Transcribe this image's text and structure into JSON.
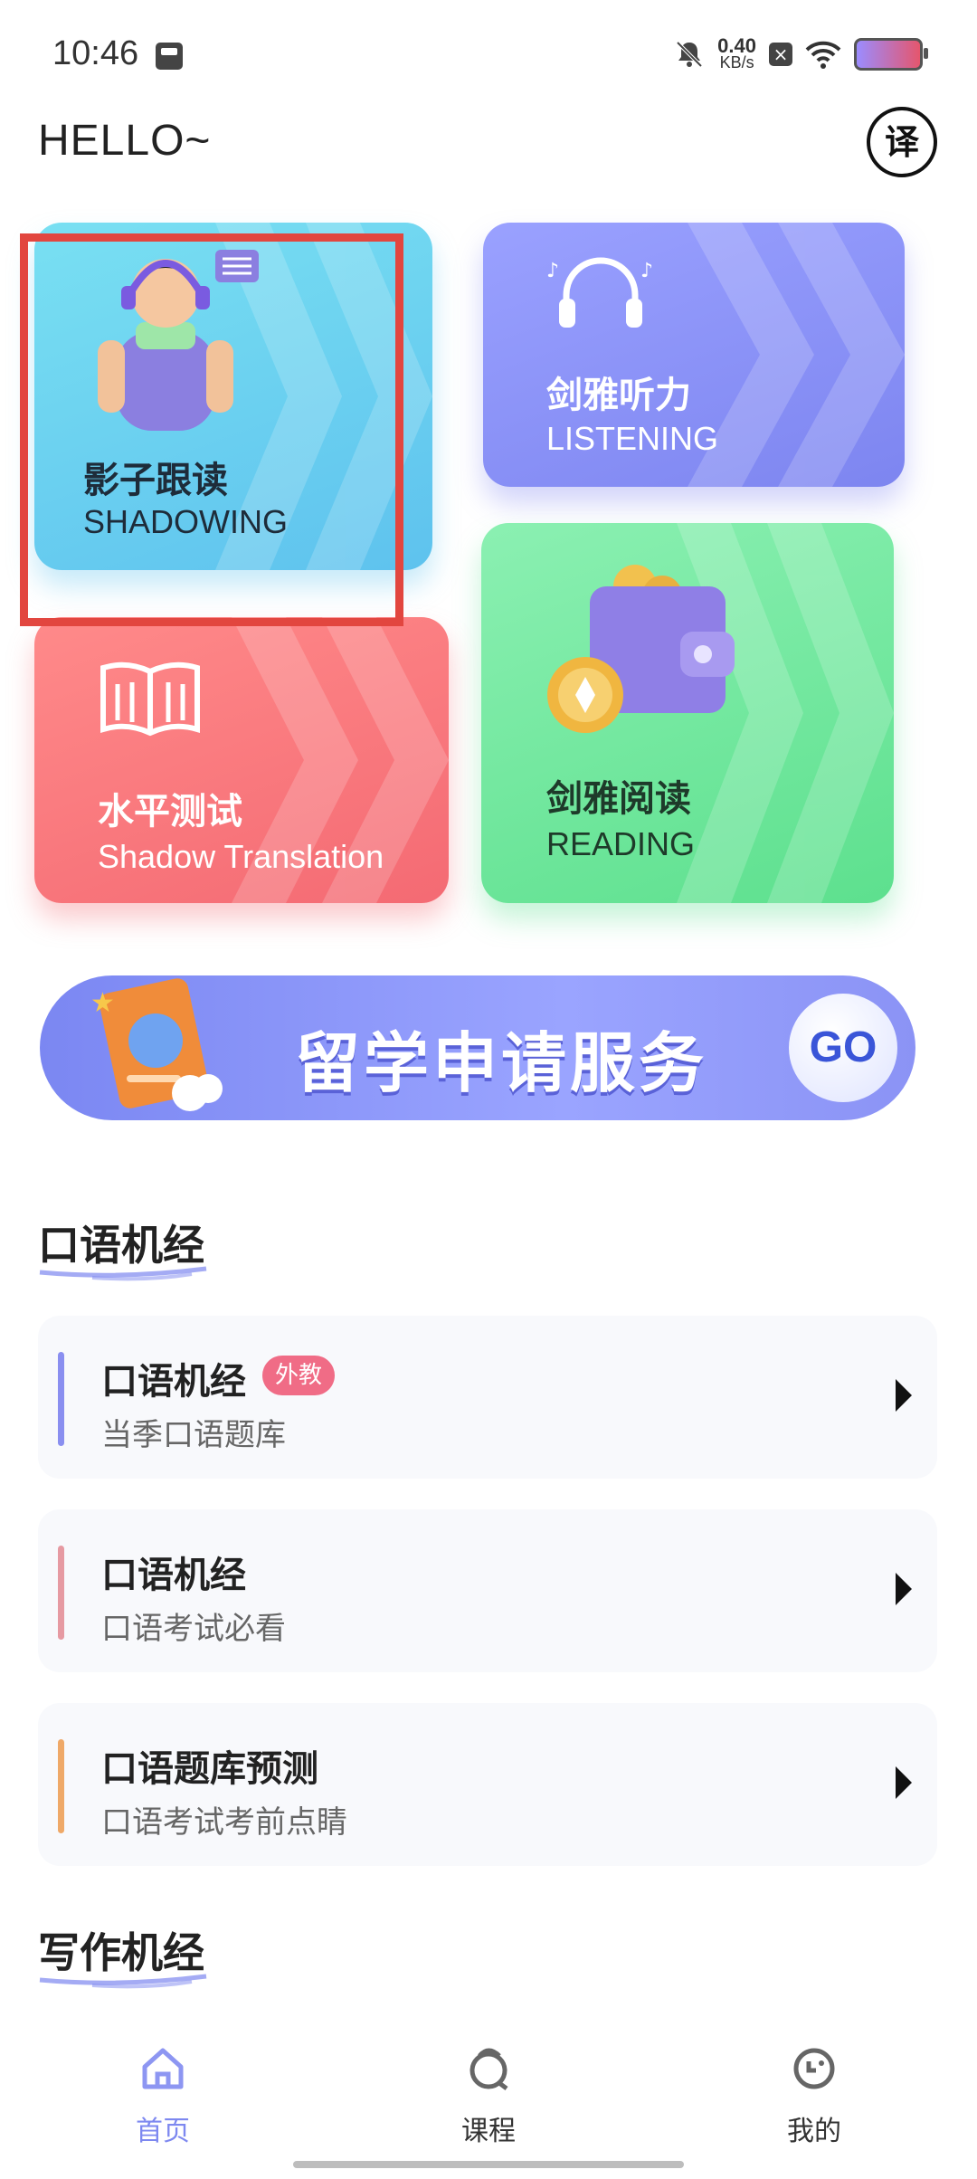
{
  "status_bar": {
    "time": "10:46",
    "net_speed_value": "0.40",
    "net_speed_unit": "KB/s"
  },
  "header": {
    "greeting": "HELLO~",
    "translate_label": "译"
  },
  "cards": {
    "shadowing": {
      "title": "影子跟读",
      "subtitle": "SHADOWING"
    },
    "listening": {
      "title": "剑雅听力",
      "subtitle": "LISTENING"
    },
    "level_test": {
      "title": "水平测试",
      "subtitle": "Shadow Translation"
    },
    "reading": {
      "title": "剑雅阅读",
      "subtitle": "READING"
    }
  },
  "banner": {
    "text": "留学申请服务",
    "go_label": "GO"
  },
  "sections": {
    "speaking": "口语机经",
    "writing": "写作机经"
  },
  "speaking_items": [
    {
      "name": "口语机经",
      "badge": "外教",
      "desc": "当季口语题库",
      "color": "#8a8ff0"
    },
    {
      "name": "口语机经",
      "desc": "口语考试必看",
      "color": "#e69aa2"
    },
    {
      "name": "口语题库预测",
      "desc": "口语考试考前点睛",
      "color": "#efa968"
    }
  ],
  "tabbar": {
    "home": "首页",
    "courses": "课程",
    "mine": "我的"
  },
  "colors": {
    "accent": "#7d88f0",
    "highlight_box": "#e2463f"
  }
}
